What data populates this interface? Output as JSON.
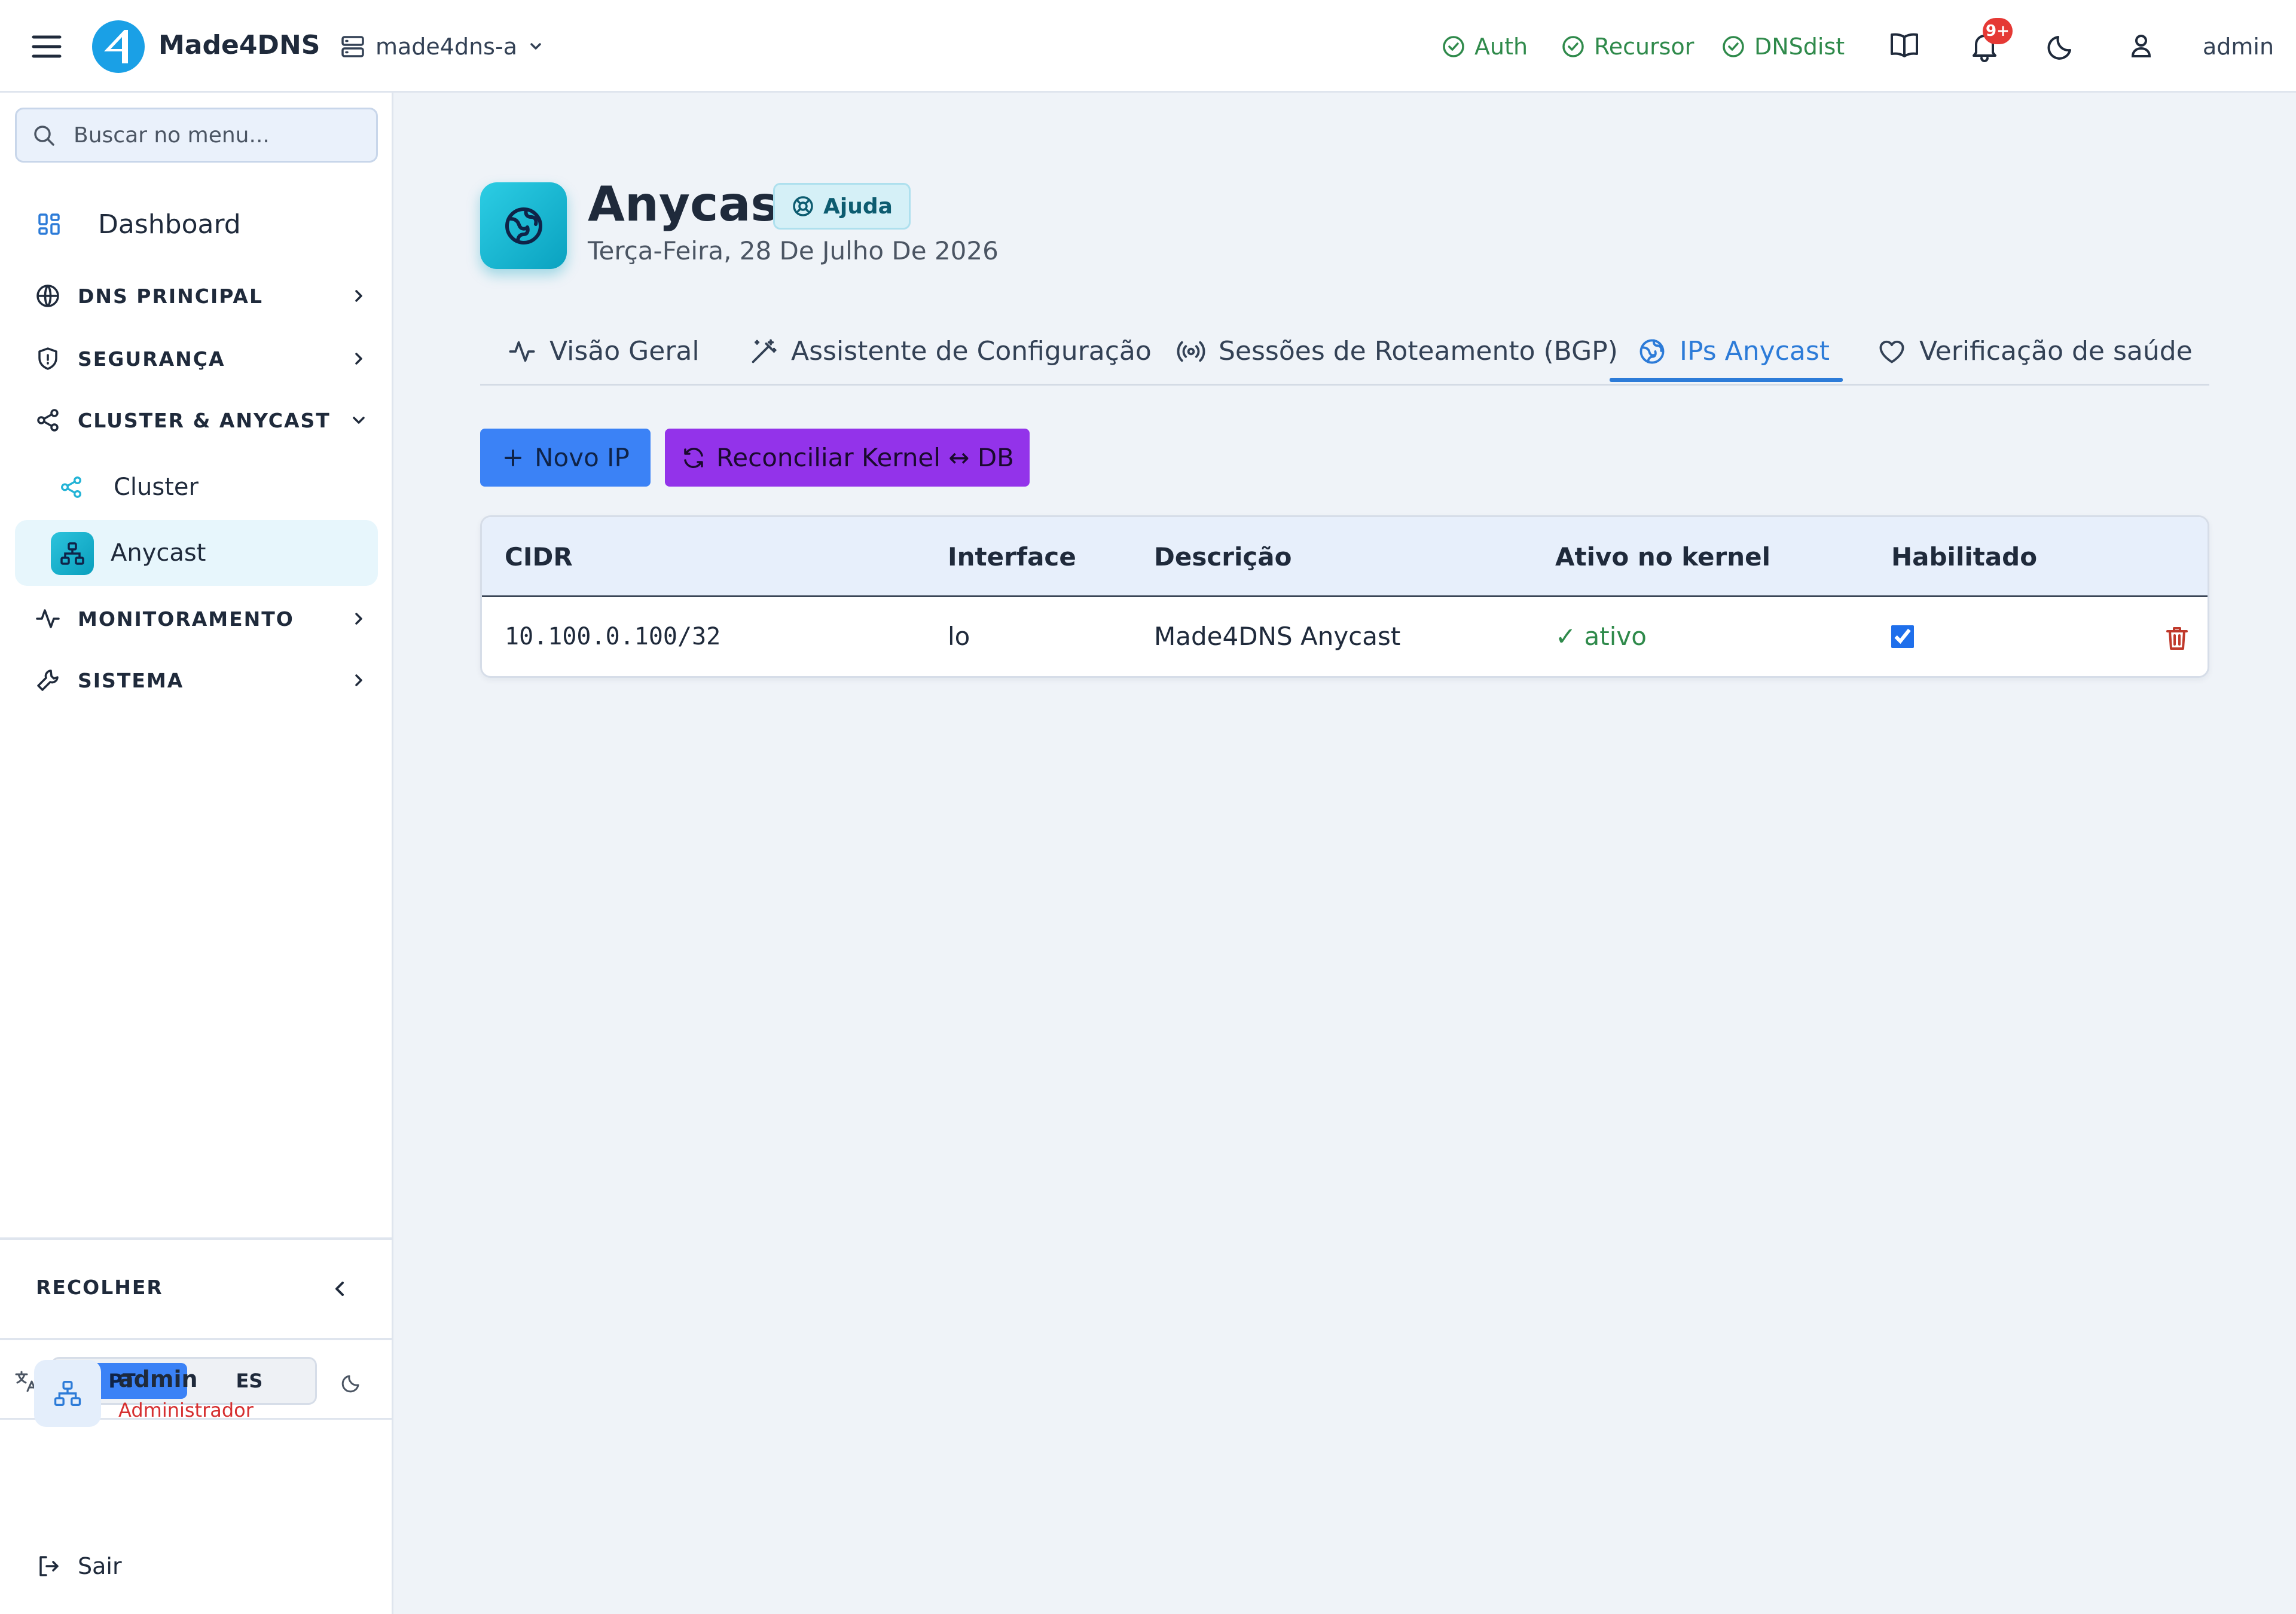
{
  "header": {
    "brand": "Made4DNS",
    "server": "made4dns-a",
    "status": [
      {
        "label": "Auth",
        "color": "#2f8a4b"
      },
      {
        "label": "Recursor",
        "color": "#2f8a4b"
      },
      {
        "label": "DNSdist",
        "color": "#2f8a4b"
      }
    ],
    "notification_badge": "9+",
    "user": "admin",
    "icons": [
      "menu-icon",
      "server-icon",
      "book-icon",
      "bell-icon",
      "moon-icon",
      "user-icon"
    ]
  },
  "sidebar": {
    "search_placeholder": "Buscar no menu...",
    "dashboard": "Dashboard",
    "sections": [
      {
        "label": "DNS PRINCIPAL",
        "expanded": false
      },
      {
        "label": "SEGURANÇA",
        "expanded": false
      },
      {
        "label": "CLUSTER & ANYCAST",
        "expanded": true
      },
      {
        "label": "MONITORAMENTO",
        "expanded": false
      },
      {
        "label": "SISTEMA",
        "expanded": false
      }
    ],
    "sub_items": [
      {
        "label": "Cluster",
        "active": false
      },
      {
        "label": "Anycast",
        "active": true
      }
    ],
    "collapse_label": "RECOLHER",
    "languages": [
      {
        "label": "PT",
        "selected": true
      },
      {
        "label": "ES",
        "selected": false
      }
    ],
    "user": {
      "name": "admin",
      "role": "Administrador"
    },
    "logout": "Sair"
  },
  "main": {
    "title": "Anycast",
    "help_label": "Ajuda",
    "date": "Terça-Feira, 28 De Julho De 2026",
    "tabs": [
      {
        "label": "Visão Geral",
        "active": false
      },
      {
        "label": "Assistente de Configuração",
        "active": false
      },
      {
        "label": "Sessões de Roteamento (BGP)",
        "active": false
      },
      {
        "label": "IPs Anycast",
        "active": true
      },
      {
        "label": "Verificação de saúde",
        "active": false
      }
    ],
    "buttons": {
      "new_ip": "Novo IP",
      "reconcile": "Reconciliar Kernel ↔ DB"
    },
    "table": {
      "columns": [
        "CIDR",
        "Interface",
        "Descrição",
        "Ativo no kernel",
        "Habilitado"
      ],
      "rows": [
        {
          "cidr": "10.100.0.100/32",
          "interface": "lo",
          "description": "Made4DNS Anycast",
          "active": "✓ ativo",
          "enabled": true
        }
      ]
    }
  },
  "colors": {
    "accent": "#2c7bd8",
    "primary_button": "#3b82f6",
    "secondary_button": "#9333ea",
    "status_ok": "#2f8a4b",
    "danger": "#c0392b",
    "brand": "#1aa0e6"
  }
}
